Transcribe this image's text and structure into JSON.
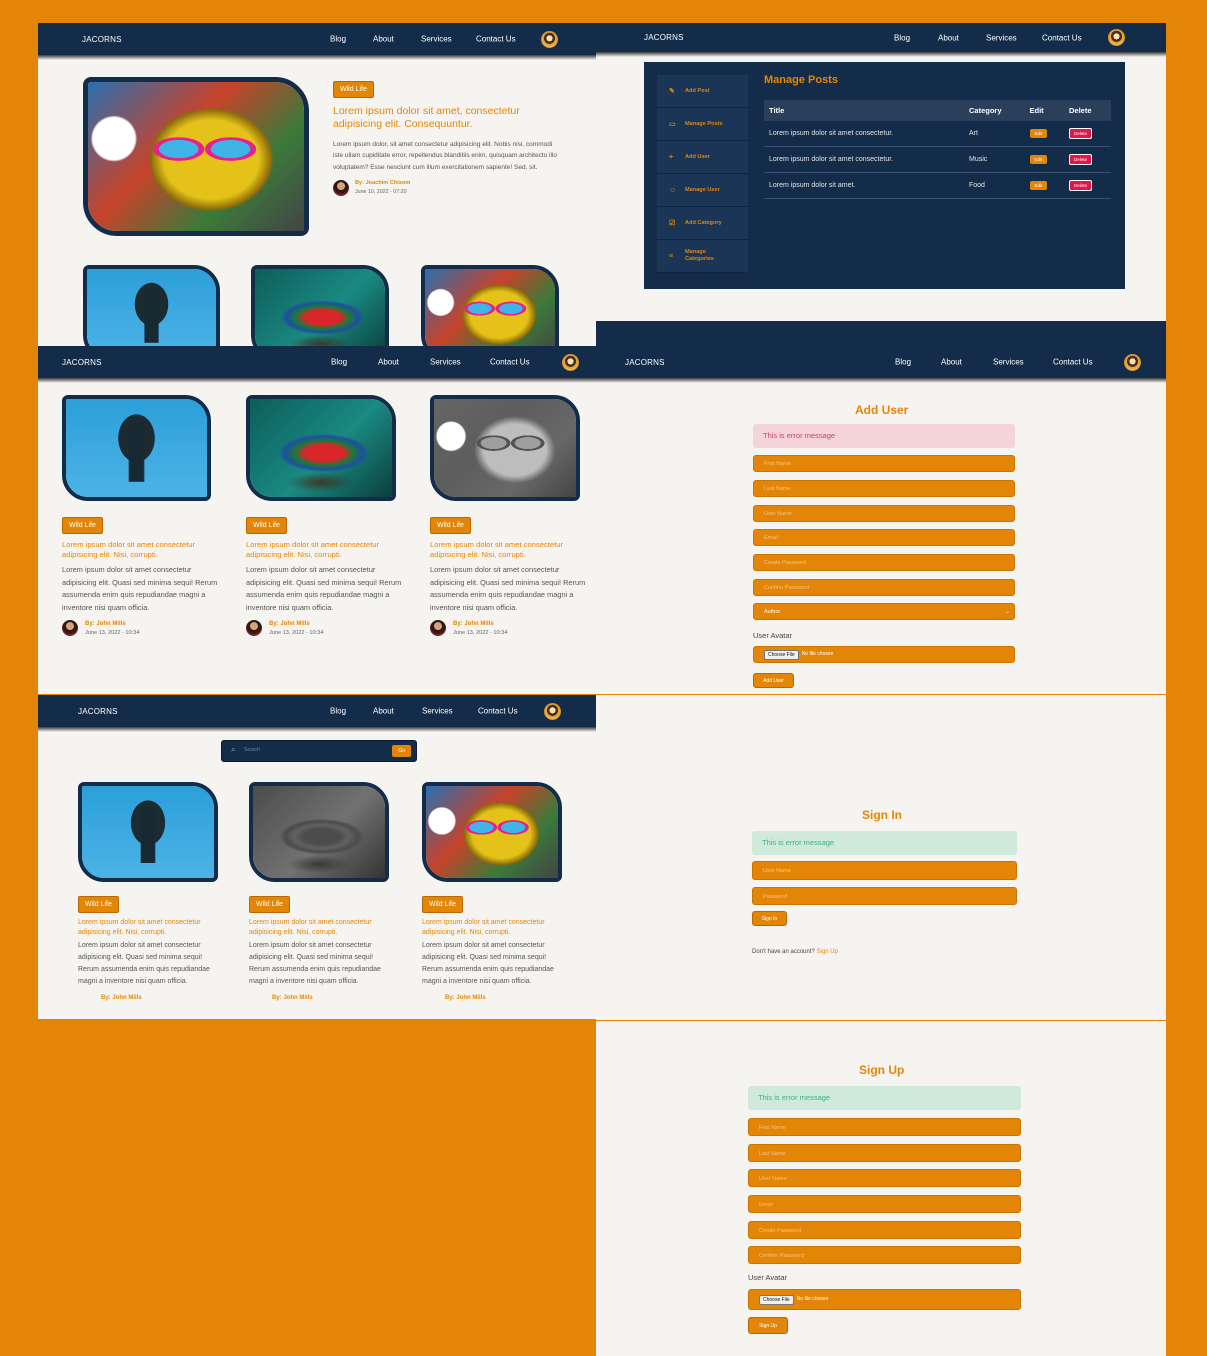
{
  "nav": {
    "brand": "JACORNS",
    "links": [
      "Blog",
      "About",
      "Services",
      "Contact Us"
    ]
  },
  "home": {
    "tag": "Wild Life",
    "title": "Lorem ipsum dolor sit amet, consectetur adipisicing elit. Consequuntur.",
    "body": "Lorem ipsum dolor, sit amet consectetur adipisicing elit. Nobis nisi, commodi iste ullam cupiditate error, repellendus blanditiis enim, quisquam architecto illo voluptatem? Esse nesciunt cum illum exercitationem sapiente! Sed, sit.",
    "author": "By: Joachim Chisom",
    "date": "June 10, 2022 - 07:20"
  },
  "card": {
    "tag": "Wild Life",
    "title": "Lorem ipsum dolor sit amet consectetur adipisicing elit. Nisi, corrupti.",
    "body": "Lorem ipsum dolor sit amet consectetur adipisicing elit. Quasi sed minima sequi! Rerum assumenda enim quis repudiandae magni a inventore nisi quam officia.",
    "author": "By: John Mills",
    "date": "June 13, 2022 - 10:34"
  },
  "search": {
    "placeholder": "Search",
    "button": "Go"
  },
  "manage": {
    "title": "Manage Posts",
    "sidebar": [
      "Add Post",
      "Manage Posts",
      "Add User",
      "Manage User",
      "Add Category",
      "Manage Categories"
    ],
    "columns": [
      "Title",
      "Category",
      "Edit",
      "Delete"
    ],
    "rows": [
      {
        "title": "Lorem ipsum dolor sit amet consectetur.",
        "category": "Art"
      },
      {
        "title": "Lorem ipsum dolor sit amet consectetur.",
        "category": "Music"
      },
      {
        "title": "Lorem ipsum dolor sit amet.",
        "category": "Food"
      }
    ],
    "edit_label": "Edit",
    "delete_label": "Delete"
  },
  "add_user": {
    "title": "Add User",
    "error": "This is error message",
    "fields": [
      "First Name",
      "Last Name",
      "User Name",
      "Email",
      "Create Password",
      "Confirm Password"
    ],
    "role": "Author",
    "avatar_label": "User Avatar",
    "choose_file": "Choose File",
    "no_file": "No file chosen",
    "submit": "Add User"
  },
  "sign_in": {
    "title": "Sign In",
    "message": "This is error message",
    "fields": [
      "User Name",
      "Password"
    ],
    "submit": "Sign In",
    "prompt": "Don't have an account?",
    "link": "Sign Up"
  },
  "sign_up": {
    "title": "Sign Up",
    "message": "This is error message",
    "fields": [
      "First Name",
      "Last Name",
      "User Name",
      "Email",
      "Create Password",
      "Confirm Password"
    ],
    "avatar_label": "User Avatar",
    "choose_file": "Choose File",
    "no_file": "No file chosen",
    "submit": "Sign Up"
  },
  "colors": {
    "navy": "#132c4a",
    "orange": "#e38607",
    "page": "#f6f4f0",
    "delete": "#e0174e",
    "error_bg": "#f4d3d9",
    "success_bg": "#cfeadb"
  }
}
